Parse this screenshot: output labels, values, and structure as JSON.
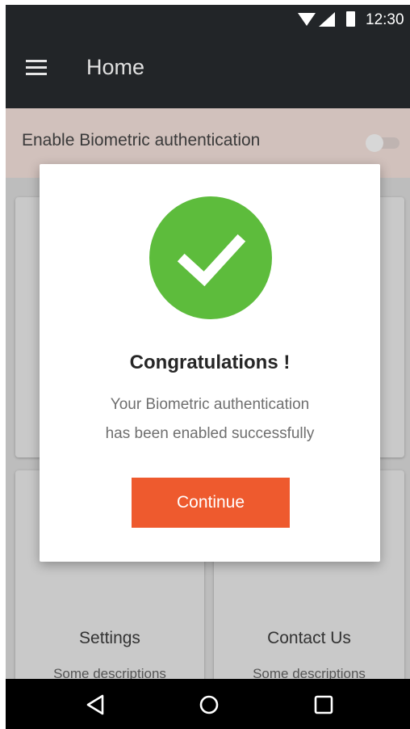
{
  "status_bar": {
    "time": "12:30",
    "icons": [
      "wifi-icon",
      "signal-icon",
      "battery-icon"
    ]
  },
  "app_bar": {
    "title": "Home",
    "menu_icon": "menu-icon"
  },
  "biometric": {
    "label": "Enable Biometric authentication",
    "enabled": false
  },
  "grid": {
    "cards": [
      {
        "title": "Settings",
        "description": "Some descriptions"
      },
      {
        "title": "Contact Us",
        "description": "Some descriptions"
      }
    ]
  },
  "dialog": {
    "icon": "check-icon",
    "title": "Congratulations !",
    "message_line1": "Your Biometric authentication",
    "message_line2": "has been enabled successfully",
    "button_label": "Continue"
  },
  "nav_bar": {
    "buttons": [
      "back-icon",
      "home-icon",
      "recents-icon"
    ]
  },
  "colors": {
    "app_bar": "#222528",
    "biometric_row": "#d1c1bc",
    "success_green": "#5dbc3c",
    "accent_orange": "#ee5a2e"
  }
}
